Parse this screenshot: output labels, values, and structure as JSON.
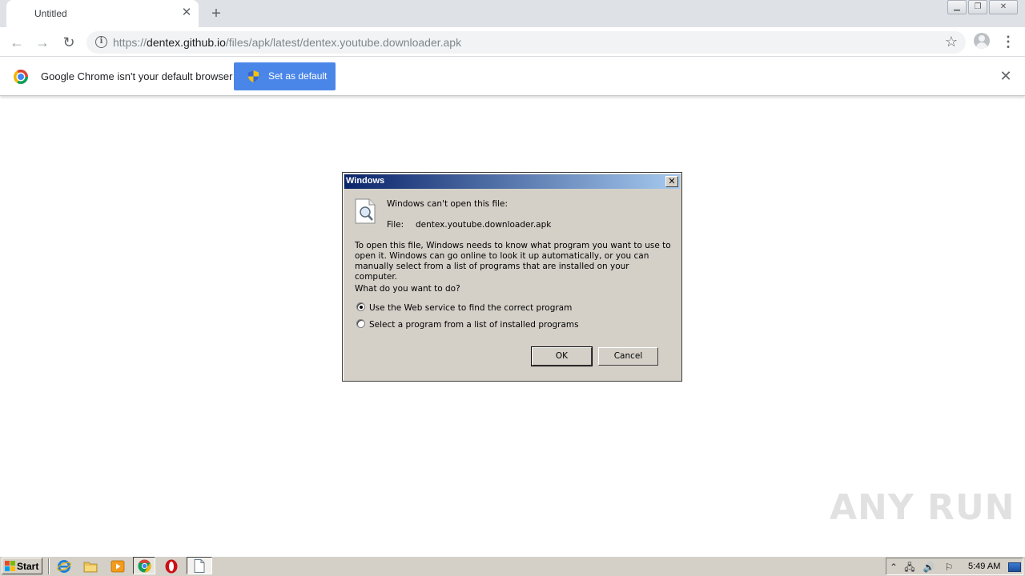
{
  "browser": {
    "tab": {
      "title": "Untitled"
    },
    "address": {
      "scheme": "https://",
      "host": "dentex.github.io",
      "path": "/files/apk/latest/dentex.youtube.downloader.apk"
    }
  },
  "infobar": {
    "message": "Google Chrome isn't your default browser",
    "button_label": "Set as default"
  },
  "dialog": {
    "title": "Windows",
    "headline": "Windows can't open this file:",
    "file_label": "File:",
    "file_name": "dentex.youtube.downloader.apk",
    "explanation": "To open this file, Windows needs to know what program you want to use to open it. Windows can go online to look it up automatically, or you can manually select from a list of programs that are installed on your computer.",
    "question": "What do you want to do?",
    "options": [
      {
        "label": "Use the Web service to find the correct program",
        "selected": true
      },
      {
        "label": "Select a program from a list of installed programs",
        "selected": false
      }
    ],
    "ok_label": "OK",
    "cancel_label": "Cancel"
  },
  "watermark": {
    "text": "ANY RUN"
  },
  "taskbar": {
    "start_label": "Start",
    "quicklaunch": [
      "internet-explorer-icon",
      "folder-icon",
      "media-player-icon",
      "chrome-icon",
      "opera-icon"
    ],
    "clock": "5:49 AM"
  },
  "colors": {
    "chrome_blue": "#4a86e8",
    "dialog_face": "#d4d0c8",
    "titlebar_start": "#0a246a",
    "titlebar_end": "#a6caf0"
  }
}
